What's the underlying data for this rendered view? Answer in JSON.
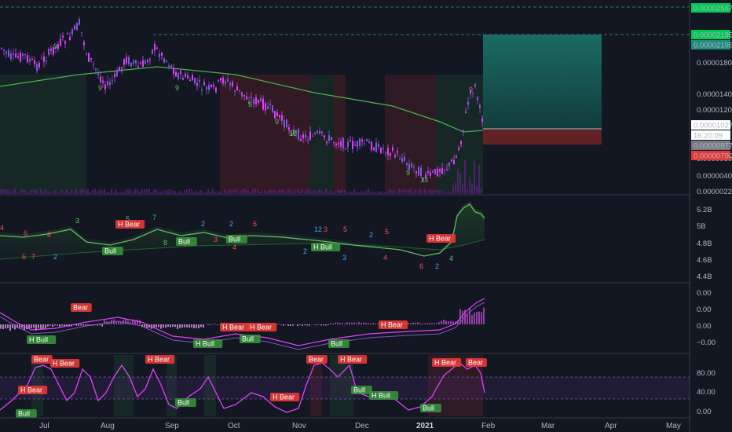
{
  "colors": {
    "background": "#131722",
    "candle_up": "#7b5bd6",
    "candle_down": "#e040fb",
    "ma_line": "#4caf50",
    "bull": "#4caf50",
    "bear": "#f05350",
    "count_green": "#66bb6a",
    "count_blue": "#42a5f5",
    "count_red": "#ef5350",
    "target_zone": "#1e6f66",
    "stop_zone": "#6b2327",
    "osc_line": "#e040fb"
  },
  "price_axis": {
    "labels": [
      "0.00001800",
      "0.00001400",
      "0.00001200",
      "0.00000600",
      "0.00000400",
      "0.00000220"
    ],
    "badges": [
      {
        "value": "0.00002567",
        "color": "#00c853",
        "text_color": "#000"
      },
      {
        "value": "0.00002195",
        "color": "#00c853",
        "text_color": "#000"
      },
      {
        "value": "0.00002195",
        "color": "#1e8c7e",
        "text_color": "#fff"
      },
      {
        "value": "0.00001027",
        "color": "#ffffff",
        "text_color": "#000"
      },
      {
        "value": "16:20:09",
        "color": "#ffffff",
        "text_color": "#000"
      },
      {
        "value": "0.00000977",
        "color": "#787b86",
        "text_color": "#fff"
      },
      {
        "value": "0.00000790",
        "color": "#e53935",
        "text_color": "#fff"
      }
    ]
  },
  "obv_axis": {
    "labels": [
      "5.2B",
      "5B",
      "4.8B",
      "4.6B",
      "4.4B"
    ]
  },
  "macd_axis": {
    "labels": [
      "0.00",
      "0.00",
      "0.00",
      "−0.00"
    ]
  },
  "rsi_axis": {
    "labels": [
      "80.00",
      "40.00",
      "0.00"
    ]
  },
  "time_axis": {
    "labels": [
      "Jul",
      "Aug",
      "Sep",
      "Oct",
      "Nov",
      "Dec",
      "2021",
      "Feb",
      "Mar",
      "Apr",
      "May"
    ],
    "bold_label": "2021"
  },
  "sequential_counts": [
    {
      "t": "9",
      "c": "green"
    },
    {
      "t": "9",
      "c": "green"
    },
    {
      "t": "9",
      "c": "green"
    },
    {
      "t": "9",
      "c": "green"
    },
    {
      "t": "9",
      "c": "green"
    },
    {
      "t": "9",
      "c": "green"
    },
    {
      "t": "13",
      "c": "green"
    },
    {
      "t": "9",
      "c": "green"
    },
    {
      "t": "13",
      "c": "green"
    },
    {
      "t": "9",
      "c": "red"
    }
  ],
  "obv_counts": [
    {
      "t": "4",
      "c": "red"
    },
    {
      "t": "6",
      "c": "red"
    },
    {
      "t": "8",
      "c": "red"
    },
    {
      "t": "5",
      "c": "red"
    },
    {
      "t": "7",
      "c": "red"
    },
    {
      "t": "2",
      "c": "blue"
    },
    {
      "t": "3",
      "c": "green"
    },
    {
      "t": "5",
      "c": "green"
    },
    {
      "t": "7",
      "c": "green"
    },
    {
      "t": "8",
      "c": "green"
    },
    {
      "t": "4",
      "c": "red"
    },
    {
      "t": "2",
      "c": "blue"
    },
    {
      "t": "3",
      "c": "red"
    },
    {
      "t": "2",
      "c": "blue"
    },
    {
      "t": "4",
      "c": "red"
    },
    {
      "t": "6",
      "c": "red"
    },
    {
      "t": "2",
      "c": "blue"
    },
    {
      "t": "12",
      "c": "blue"
    },
    {
      "t": "3",
      "c": "red"
    },
    {
      "t": "5",
      "c": "red"
    },
    {
      "t": "3",
      "c": "blue"
    },
    {
      "t": "2",
      "c": "blue"
    },
    {
      "t": "5",
      "c": "red"
    },
    {
      "t": "4",
      "c": "red"
    },
    {
      "t": "6",
      "c": "red"
    },
    {
      "t": "2",
      "c": "blue"
    },
    {
      "t": "4",
      "c": "green"
    }
  ],
  "divergence_tags": {
    "obv": [
      {
        "t": "H Bear",
        "k": "bear"
      },
      {
        "t": "Bull",
        "k": "bull"
      },
      {
        "t": "Bull",
        "k": "bull"
      },
      {
        "t": "Bull",
        "k": "bull"
      },
      {
        "t": "H Bull",
        "k": "bull"
      },
      {
        "t": "H Bear",
        "k": "bear"
      }
    ],
    "macd": [
      {
        "t": "Bear",
        "k": "bear"
      },
      {
        "t": "H Bull",
        "k": "bull"
      },
      {
        "t": "H Bear",
        "k": "bear"
      },
      {
        "t": "H Bear",
        "k": "bear"
      },
      {
        "t": "H Bull",
        "k": "bull"
      },
      {
        "t": "Bull",
        "k": "bull"
      },
      {
        "t": "Bull",
        "k": "bull"
      },
      {
        "t": "H Bear",
        "k": "bear"
      }
    ],
    "rsi": [
      {
        "t": "H Bear",
        "k": "bear"
      },
      {
        "t": "Bear",
        "k": "bear"
      },
      {
        "t": "H Bear",
        "k": "bear"
      },
      {
        "t": "Bull",
        "k": "bull"
      },
      {
        "t": "Bull",
        "k": "bull"
      },
      {
        "t": "H Bear",
        "k": "bear"
      },
      {
        "t": "H Bear",
        "k": "bear"
      },
      {
        "t": "Bear",
        "k": "bear"
      },
      {
        "t": "Bull",
        "k": "bull"
      },
      {
        "t": "H Bull",
        "k": "bull"
      },
      {
        "t": "Bull",
        "k": "bull"
      },
      {
        "t": "H Bear",
        "k": "bear"
      },
      {
        "t": "Bear",
        "k": "bear"
      },
      {
        "t": "H Bear",
        "k": "bear"
      }
    ]
  }
}
